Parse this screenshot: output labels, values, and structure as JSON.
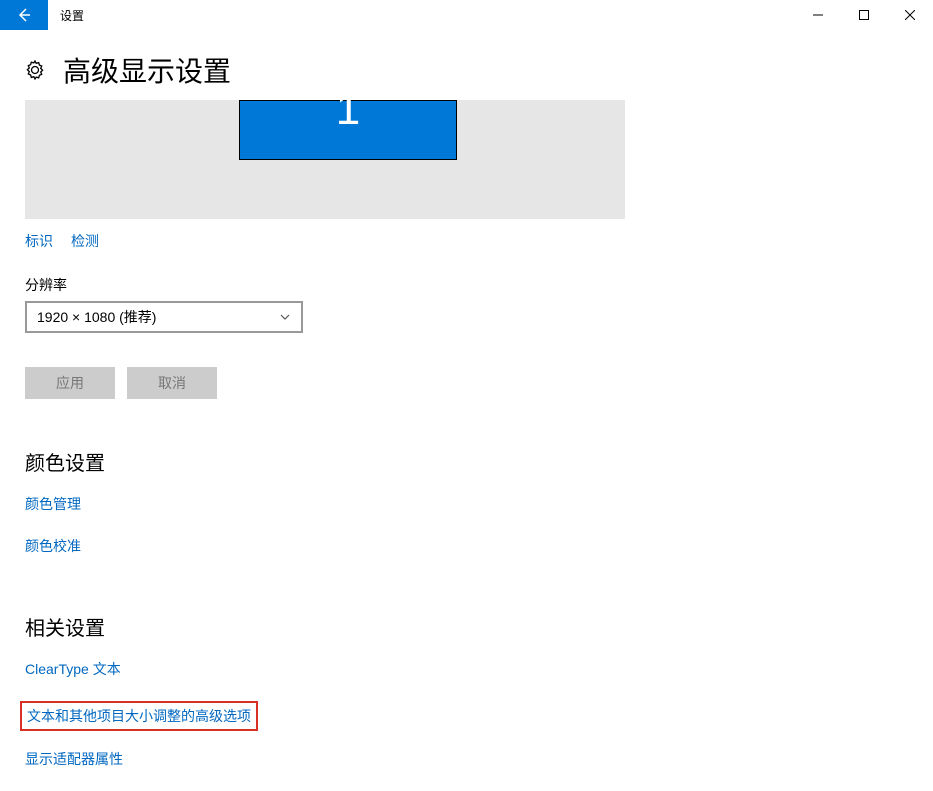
{
  "titlebar": {
    "title": "设置"
  },
  "header": {
    "page_title": "高级显示设置"
  },
  "monitor": {
    "label": "1"
  },
  "monitor_links": {
    "identify": "标识",
    "detect": "检测"
  },
  "resolution": {
    "label": "分辨率",
    "value": "1920 × 1080 (推荐)"
  },
  "buttons": {
    "apply": "应用",
    "cancel": "取消"
  },
  "color_section": {
    "heading": "颜色设置",
    "manage": "颜色管理",
    "calibrate": "颜色校准"
  },
  "related_section": {
    "heading": "相关设置",
    "cleartype": "ClearType 文本",
    "text_sizing": "文本和其他项目大小调整的高级选项",
    "adapter": "显示适配器属性"
  }
}
